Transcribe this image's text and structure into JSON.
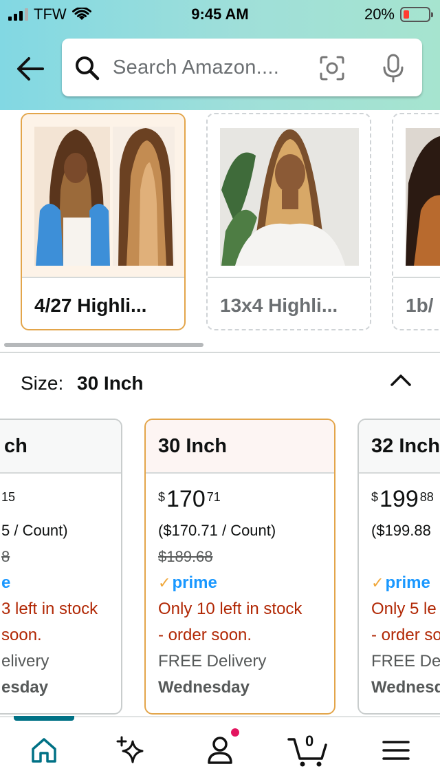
{
  "status_bar": {
    "carrier": "TFW",
    "time": "9:45 AM",
    "battery": "20%"
  },
  "search": {
    "placeholder": "Search Amazon...."
  },
  "styles": {
    "items": [
      {
        "label": "4/27 Highli...",
        "selected": true
      },
      {
        "label": "13x4 Highli...",
        "selected": false
      },
      {
        "label": "1b/",
        "selected": false
      }
    ]
  },
  "size": {
    "label": "Size:",
    "selected": "30 Inch"
  },
  "size_options": [
    {
      "title": "ch",
      "price_fragment": "15",
      "per_count": "5 / Count)",
      "list_price": "8",
      "prime": "e",
      "stock_1": "3 left in stock",
      "stock_2": "soon.",
      "delivery": "elivery",
      "day": "esday"
    },
    {
      "title": "30 Inch",
      "currency": "$",
      "price_whole": "170",
      "price_cents": "71",
      "per_count": "($170.71 / Count)",
      "list_price": "$189.68",
      "prime": "prime",
      "stock_1": "Only 10 left in stock",
      "stock_2": "- order soon.",
      "delivery": "FREE Delivery",
      "day": "Wednesday"
    },
    {
      "title": "32 Inch",
      "currency": "$",
      "price_whole": "199",
      "price_cents": "88",
      "per_count": "($199.88",
      "prime": "prime",
      "stock_1": "Only 5 le",
      "stock_2": "- order so",
      "delivery": "FREE Del",
      "day": "Wednesd"
    }
  ],
  "nav": {
    "cart_count": "0",
    "active": "home"
  },
  "colors": {
    "accent": "#007185",
    "selected_border": "#e3a54a",
    "prime_blue": "#1a98ff",
    "stock_red": "#b12704",
    "notification": "#e3145f"
  }
}
